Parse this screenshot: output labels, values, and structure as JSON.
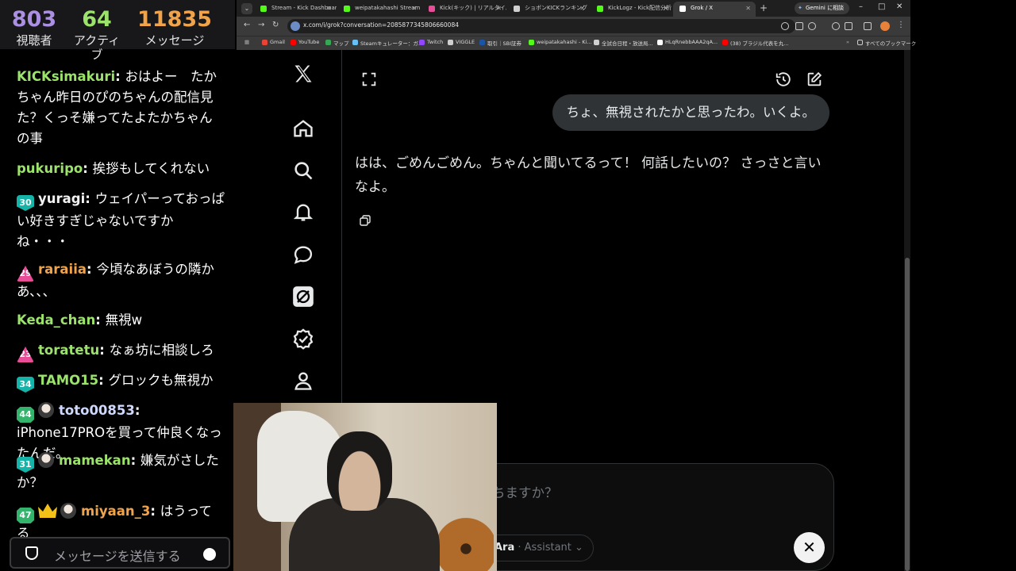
{
  "stats": {
    "viewers": "803",
    "viewers_label": "視聴者",
    "active": "64",
    "active_label": "アクティブ",
    "messages": "11835",
    "messages_label": "メッセージ"
  },
  "chat": {
    "messages": [
      {
        "user": "KICKsimakuri",
        "user_color": "#9be36a",
        "text": "おはよー　たかちゃん昨日のぴのちゃんの配信見た？くっそ嫌ってたよたかちゃんの事"
      },
      {
        "user": "pukuripo",
        "user_color": "#9be36a",
        "text": "挨拶もしてくれない"
      },
      {
        "badge": "30",
        "user": "yuragi",
        "user_color": "#f2f2f2",
        "text": "ウェイパーっておっぱい好きすぎじゃないですかね・・・"
      },
      {
        "badge": "29",
        "user": "raraiia",
        "user_color": "#f0a34a",
        "text": "今頃なあぼうの隣かあ､､､"
      },
      {
        "user": "Keda_chan",
        "user_color": "#9be36a",
        "text": "無視w"
      },
      {
        "badge": "23",
        "user": "toratetu",
        "user_color": "#9be36a",
        "text": "なぁ坊に相談しろ"
      },
      {
        "badge": "34",
        "user": "TAMO15",
        "user_color": "#9be36a",
        "text": "グロックも無視か"
      },
      {
        "badge": "44",
        "user": "toto00853",
        "user_color": "#cfd8ff",
        "text": "iPhone17PROを買って仲良くなったんだ。"
      },
      {
        "badge": "31",
        "user": "mamekan",
        "user_color": "#9be36a",
        "text": "嫌気がさしたか？"
      },
      {
        "badge": "47",
        "user": "miyaan_3",
        "user_color": "#f0a34a",
        "text": "はうってる"
      }
    ],
    "input_placeholder": "メッセージを送信する"
  },
  "browser": {
    "tabs": [
      {
        "title": "Stream - Kick Dashboard",
        "fav": "#53fc18"
      },
      {
        "title": "weipatakahashi Stream",
        "fav": "#53fc18"
      },
      {
        "title": "Kick(キック) | リアルタイム",
        "fav": "#e84d98"
      },
      {
        "title": "ショボンKICKランキング | S",
        "fav": "#cfcfcf"
      },
      {
        "title": "KickLogz - Kick配信分析",
        "fav": "#53fc18"
      },
      {
        "title": "Grok / X",
        "fav": "#ffffff"
      }
    ],
    "gemini": "Gemini に相談",
    "url": "x.com/i/grok?conversation=2085877345806660084",
    "bookmarks": [
      "Gmail",
      "YouTube",
      "マップ",
      "Steamキュレーター：ガ...",
      "Twitch",
      "VIGGLE",
      "取引｜SBI証券",
      "weipatakahashi - Ki...",
      "全試合日程・放送局...",
      "HLqRnebbAAA2qA...",
      "(38) ブラジル代表を丸...",
      "すべてのブックマーク"
    ]
  },
  "grok": {
    "user_message": "ちょ、無視されたかと思ったわ。いくよ。",
    "reply": "はは、ごめんごめん。ちゃんと聞いてるって！ 何話したいの？ さっさと言いなよ。",
    "composer_placeholder": "ちますか？",
    "mode_name": "Ara",
    "mode_sub": "· Assistant"
  }
}
